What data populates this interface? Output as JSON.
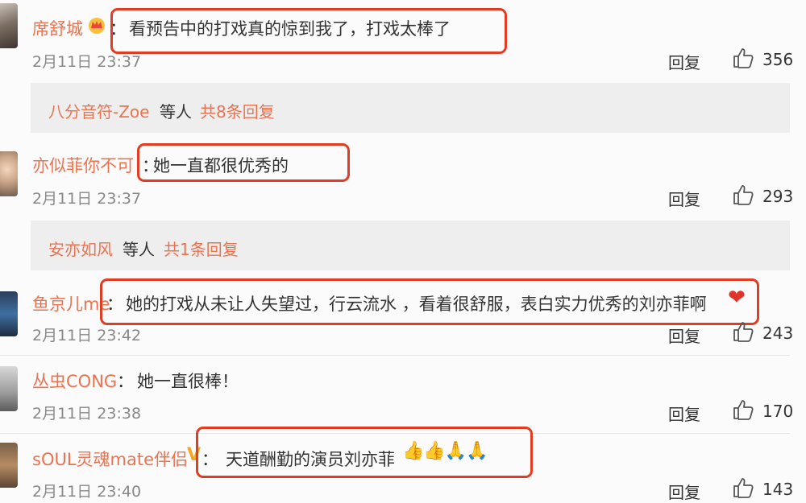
{
  "comments": [
    {
      "user": "席舒城",
      "colon": "：",
      "text": "看预告中的打戏真的惊到我了，打戏太棒了",
      "time": "2月11日 23:37",
      "reply": "回复",
      "likes": "356",
      "replies": {
        "user": "八分音符-Zoe",
        "etc": "等人",
        "more": "共8条回复"
      }
    },
    {
      "user": "亦似菲你不可",
      "colon": "：",
      "text": "她一直都很优秀的",
      "time": "2月11日 23:37",
      "reply": "回复",
      "likes": "293",
      "replies": {
        "user": "安亦如风",
        "etc": "等人",
        "more": "共1条回复"
      }
    },
    {
      "user": "鱼京儿me",
      "colon": "：",
      "text": "她的打戏从未让人失望过，行云流水 ，看着很舒服，表白实力优秀的刘亦菲啊",
      "time": "2月11日 23:42",
      "reply": "回复",
      "likes": "243"
    },
    {
      "user": "丛虫CONG",
      "colon": "：",
      "text": "她一直很棒！",
      "time": "2月11日 23:38",
      "reply": "回复",
      "likes": "170"
    },
    {
      "user": "sOUL灵魂mate伴侣",
      "colon": "：",
      "text": "天道酬勤的演员刘亦菲",
      "time": "2月11日 23:40",
      "reply": "回复",
      "likes": "143"
    }
  ],
  "colors": {
    "username": "#eb7350",
    "highlight_box": "#e23c22",
    "reply_panel": "#eeeeee"
  },
  "icons": {
    "like": "thumbs-up-icon",
    "vip": "crown-icon",
    "verified": "v-badge-icon",
    "heart": "heart-emoji",
    "emoji": "thumbs-up-emoji"
  }
}
